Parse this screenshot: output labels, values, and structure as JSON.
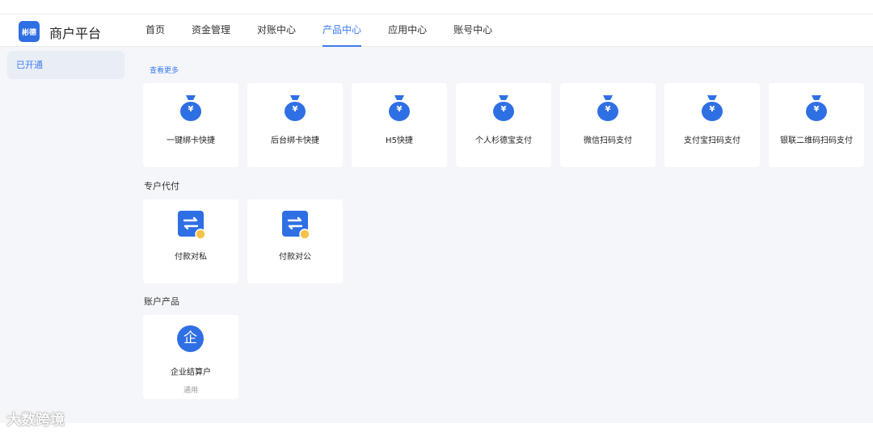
{
  "header": {
    "logo_text": "彬德",
    "title": "商户平台",
    "nav": [
      {
        "label": "首页"
      },
      {
        "label": "资金管理"
      },
      {
        "label": "对账中心"
      },
      {
        "label": "产品中心",
        "active": true
      },
      {
        "label": "应用中心"
      },
      {
        "label": "账号中心"
      }
    ]
  },
  "sidebar": {
    "items": [
      {
        "label": "已开通",
        "active": true
      }
    ]
  },
  "main": {
    "more_link": "查看更多",
    "payment_products": [
      {
        "label": "一键绑卡快捷",
        "icon": "money-bag-icon"
      },
      {
        "label": "后台绑卡快捷",
        "icon": "money-bag-icon"
      },
      {
        "label": "H5快捷",
        "icon": "money-bag-icon"
      },
      {
        "label": "个人杉德宝支付",
        "icon": "money-bag-icon"
      },
      {
        "label": "微信扫码支付",
        "icon": "money-bag-icon"
      },
      {
        "label": "支付宝扫码支付",
        "icon": "money-bag-icon"
      },
      {
        "label": "银联二维码扫码支付",
        "icon": "money-bag-icon"
      }
    ],
    "payout_section": {
      "title": "专户代付",
      "items": [
        {
          "label": "付款对私",
          "icon": "transfer-private-icon"
        },
        {
          "label": "付款对公",
          "icon": "transfer-public-icon"
        }
      ]
    },
    "account_section": {
      "title": "账户产品",
      "items": [
        {
          "label": "企业结算户",
          "sub": "通用",
          "icon_char": "企",
          "icon": "enterprise-icon"
        }
      ]
    }
  },
  "watermark": "大数跨境",
  "colors": {
    "accent": "#3d7af5",
    "background": "#f5f6f9",
    "badge": "#f5c34a"
  }
}
